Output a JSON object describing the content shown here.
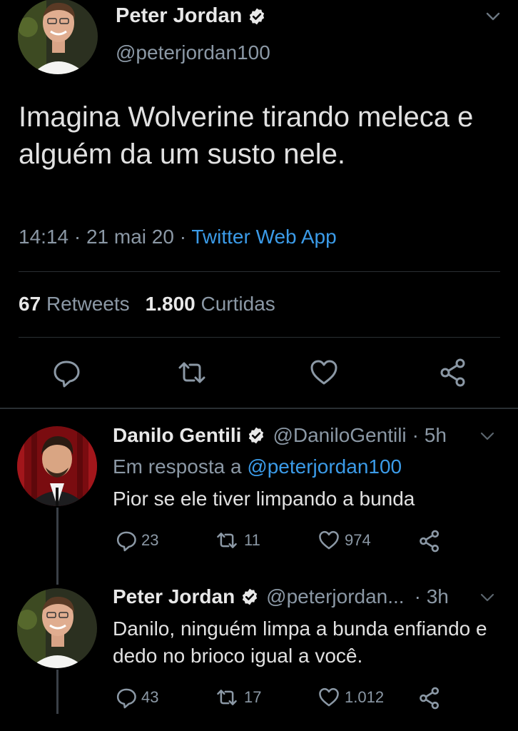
{
  "main_tweet": {
    "author_name": "Peter Jordan",
    "handle": "@peterjordan100",
    "text": "Imagina Wolverine tirando meleca e alguém da um susto nele.",
    "time": "14:14",
    "date": "21 mai 20",
    "separator": "·",
    "source": "Twitter Web App",
    "retweets_count": "67",
    "retweets_label": "Retweets",
    "likes_count": "1.800",
    "likes_label": "Curtidas"
  },
  "replies": [
    {
      "author_name": "Danilo Gentili",
      "handle": "@DaniloGentili",
      "time": "· 5h",
      "reply_to_label": "Em resposta a",
      "reply_to_handle": "@peterjordan100",
      "text": "Pior se ele tiver limpando a bunda",
      "replies": "23",
      "retweets": "11",
      "likes": "974"
    },
    {
      "author_name": "Peter Jordan",
      "handle": "@peterjordan...",
      "time": "· 3h",
      "text": "Danilo, ninguém limpa a bunda enfiando e dedo no brioco igual a você.",
      "replies": "43",
      "retweets": "17",
      "likes": "1.012"
    }
  ],
  "colors": {
    "background": "#000000",
    "link": "#3b9be8",
    "muted": "#8b98a5",
    "text": "#e1e1e1",
    "divider": "#2a2f33"
  },
  "icons": [
    "verified-badge-icon",
    "chevron-down-icon",
    "reply-icon",
    "retweet-icon",
    "like-icon",
    "share-icon"
  ]
}
